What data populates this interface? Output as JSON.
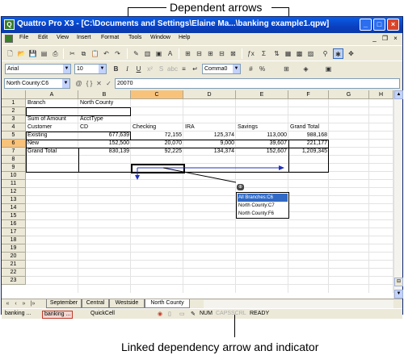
{
  "callouts": {
    "top": "Dependent arrows",
    "bottom": "Linked dependency arrow and indicator"
  },
  "window": {
    "title": "Quattro Pro X3 - [C:\\Documents and Settings\\Elaine Ma...\\banking example1.qpw]",
    "buttons": [
      "_",
      "□",
      "×"
    ]
  },
  "menu": [
    "File",
    "Edit",
    "View",
    "Insert",
    "Format",
    "Tools",
    "Window",
    "Help"
  ],
  "toolbar2": {
    "font": "Arial",
    "size": "10",
    "style": "Comma0",
    "bold": "B",
    "italic": "I",
    "underline": "U"
  },
  "input_line": {
    "cell_name": "North County:C6",
    "formula": "20070",
    "at_icon": "@",
    "braces_icon": "{ }",
    "cancel_icon": "✕",
    "ok_icon": "✓"
  },
  "columns": [
    "A",
    "B",
    "C",
    "D",
    "E",
    "F",
    "G",
    "H"
  ],
  "selected_column": "C",
  "selected_row": "6",
  "rows": [
    "1",
    "2",
    "3",
    "4",
    "5",
    "6",
    "7",
    "8",
    "9",
    "10",
    "11",
    "12",
    "13",
    "14",
    "15",
    "16",
    "17",
    "18",
    "19",
    "20",
    "21",
    "22",
    "23"
  ],
  "cells": {
    "A1": "Branch",
    "B1": "North County",
    "A3": "Sum of Amount",
    "B3": "AcctType",
    "A4": "Customer",
    "B4": "CD",
    "C4": "Checking",
    "D4": "IRA",
    "E4": "Savings",
    "F4": "Grand Total",
    "A5": "Existing",
    "B5": "677,639",
    "C5": "72,155",
    "D5": "125,374",
    "E5": "113,000",
    "F5": "988,168",
    "A6": "New",
    "B6": "152,500",
    "C6": "20,070",
    "D6": "9,000",
    "E6": "39,607",
    "F6": "221,177",
    "A7": "Grand Total",
    "B7": "830,139",
    "C7": "92,225",
    "D7": "134,374",
    "E7": "152,607",
    "F7": "1,209,345"
  },
  "dependency_popup": {
    "items": [
      "All Branches:C6",
      "North County:C7",
      "North County:F6"
    ],
    "selected_index": 0,
    "indicator_icon": "linked-dependency-indicator"
  },
  "sheet_tabs": [
    "September",
    "Central",
    "Westside",
    "North County"
  ],
  "active_tab": "North County",
  "tab_nav": [
    "«",
    "‹",
    "»",
    "|»"
  ],
  "status": {
    "file1": "banking ...",
    "file2": "banking ...",
    "quickcell": "QuickCell",
    "num": "NUM",
    "caps": "CAPS",
    "scrl": "SCRL",
    "ready": "READY"
  },
  "colors": {
    "titlebar": "#0a4fd6",
    "selection_header": "#f9c27a",
    "arrow_blue": "#1f2fbf",
    "popup_selected": "#316ac5"
  }
}
